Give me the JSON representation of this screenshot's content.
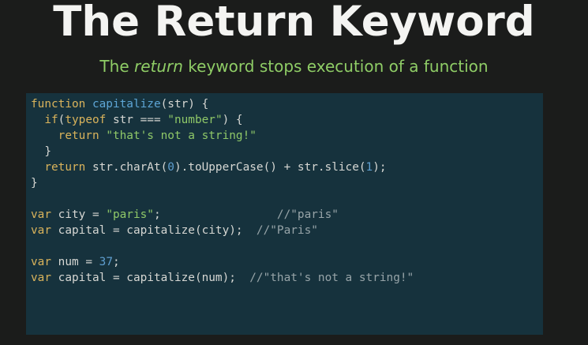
{
  "slide": {
    "title": "The Return Keyword",
    "subtitle_before": "The ",
    "subtitle_emphasis": "return",
    "subtitle_after": " keyword stops execution of a function"
  },
  "code_lines": [
    [
      {
        "text": "function ",
        "kind": "kw"
      },
      {
        "text": "capitalize",
        "kind": "fn"
      },
      {
        "text": "(str) {",
        "kind": "plain"
      }
    ],
    [
      {
        "text": "  ",
        "kind": "plain"
      },
      {
        "text": "if",
        "kind": "kw"
      },
      {
        "text": "(",
        "kind": "plain"
      },
      {
        "text": "typeof",
        "kind": "kw"
      },
      {
        "text": " str === ",
        "kind": "plain"
      },
      {
        "text": "\"number\"",
        "kind": "str"
      },
      {
        "text": ") {",
        "kind": "plain"
      }
    ],
    [
      {
        "text": "    ",
        "kind": "plain"
      },
      {
        "text": "return",
        "kind": "kw"
      },
      {
        "text": " ",
        "kind": "plain"
      },
      {
        "text": "\"that's not a string!\"",
        "kind": "str"
      }
    ],
    [
      {
        "text": "  }",
        "kind": "plain"
      }
    ],
    [
      {
        "text": "  ",
        "kind": "plain"
      },
      {
        "text": "return",
        "kind": "kw"
      },
      {
        "text": " str.charAt(",
        "kind": "plain"
      },
      {
        "text": "0",
        "kind": "num"
      },
      {
        "text": ").toUpperCase() + str.slice(",
        "kind": "plain"
      },
      {
        "text": "1",
        "kind": "num"
      },
      {
        "text": ");",
        "kind": "plain"
      }
    ],
    [
      {
        "text": "}",
        "kind": "plain"
      }
    ],
    [],
    [
      {
        "text": "var",
        "kind": "kw"
      },
      {
        "text": " city = ",
        "kind": "plain"
      },
      {
        "text": "\"paris\"",
        "kind": "str"
      },
      {
        "text": ";                 ",
        "kind": "plain"
      },
      {
        "text": "//\"paris\"",
        "kind": "cmt"
      }
    ],
    [
      {
        "text": "var",
        "kind": "kw"
      },
      {
        "text": " capital = capitalize(city);  ",
        "kind": "plain"
      },
      {
        "text": "//\"Paris\"",
        "kind": "cmt"
      }
    ],
    [],
    [
      {
        "text": "var",
        "kind": "kw"
      },
      {
        "text": " num = ",
        "kind": "plain"
      },
      {
        "text": "37",
        "kind": "num"
      },
      {
        "text": ";",
        "kind": "plain"
      }
    ],
    [
      {
        "text": "var",
        "kind": "kw"
      },
      {
        "text": " capital = capitalize(num);  ",
        "kind": "plain"
      },
      {
        "text": "//\"that's not a string!\"",
        "kind": "cmt"
      }
    ]
  ]
}
